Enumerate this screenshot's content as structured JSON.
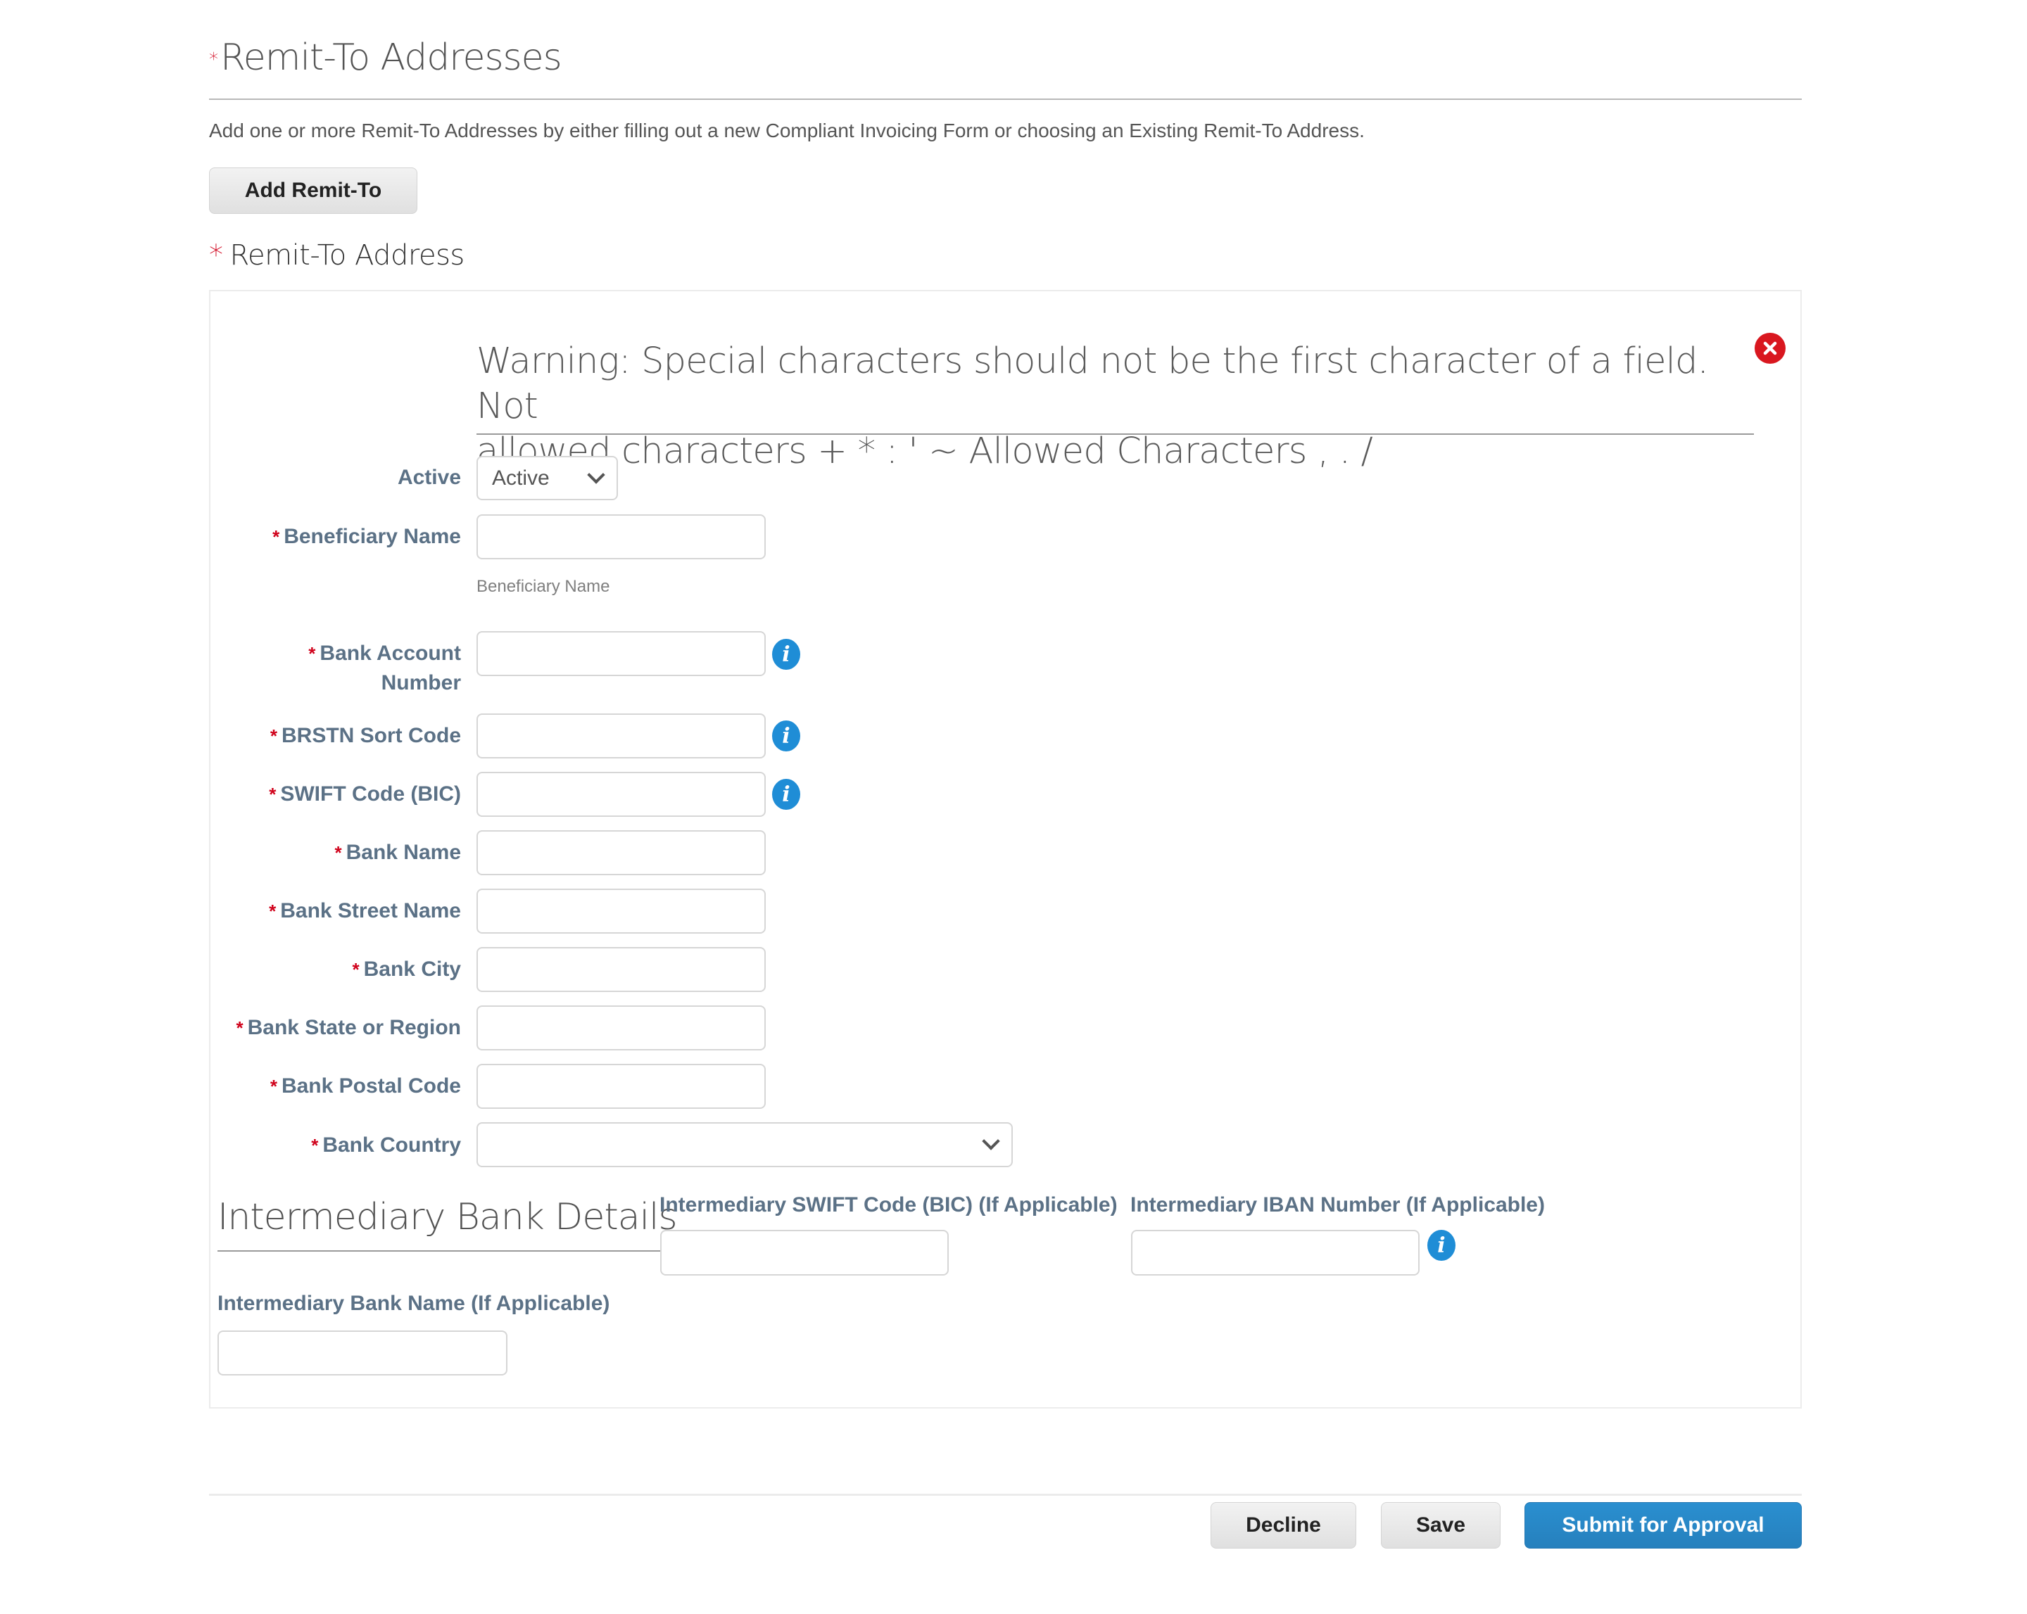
{
  "header": {
    "required_marker": "*",
    "title": "Remit-To Addresses",
    "description": "Add one or more Remit-To Addresses by either filling out a new Compliant Invoicing Form or choosing an Existing Remit-To Address.",
    "add_button": "Add Remit-To"
  },
  "section": {
    "required_marker": "*",
    "title": "Remit-To Address",
    "warning_line1": "Warning: Special characters should not be the first character of a field. Not",
    "warning_line2": "allowed characters + * : ' ~ Allowed Characters , . /",
    "close_icon": "close-circle-icon"
  },
  "form": {
    "active": {
      "label": "Active",
      "value": "Active"
    },
    "beneficiary_name": {
      "label": "Beneficiary Name",
      "value": "",
      "helper": "Beneficiary Name"
    },
    "bank_account_number": {
      "label_line1": "Bank Account",
      "label_line2": "Number",
      "value": ""
    },
    "brstn_sort_code": {
      "label": "BRSTN Sort Code",
      "value": ""
    },
    "swift_code": {
      "label": "SWIFT Code (BIC)",
      "value": ""
    },
    "bank_name": {
      "label": "Bank Name",
      "value": ""
    },
    "bank_street_name": {
      "label": "Bank Street Name",
      "value": ""
    },
    "bank_city": {
      "label": "Bank City",
      "value": ""
    },
    "bank_state_region": {
      "label": "Bank State or Region",
      "value": ""
    },
    "bank_postal_code": {
      "label": "Bank Postal Code",
      "value": ""
    },
    "bank_country": {
      "label": "Bank Country",
      "value": ""
    },
    "required_marker": "*",
    "info_icon": "i"
  },
  "intermediary": {
    "title": "Intermediary Bank Details",
    "swift_label": "Intermediary SWIFT Code (BIC) (If Applicable)",
    "iban_label": "Intermediary IBAN Number (If Applicable)",
    "bank_name_label": "Intermediary Bank Name (If Applicable)",
    "swift_value": "",
    "iban_value": "",
    "bank_name_value": ""
  },
  "footer": {
    "decline": "Decline",
    "save": "Save",
    "submit": "Submit for Approval"
  },
  "colors": {
    "required": "#d0021b",
    "label": "#5b7186",
    "primary": "#2a8fd0",
    "error": "#d9171f",
    "info": "#1f8dd6"
  }
}
